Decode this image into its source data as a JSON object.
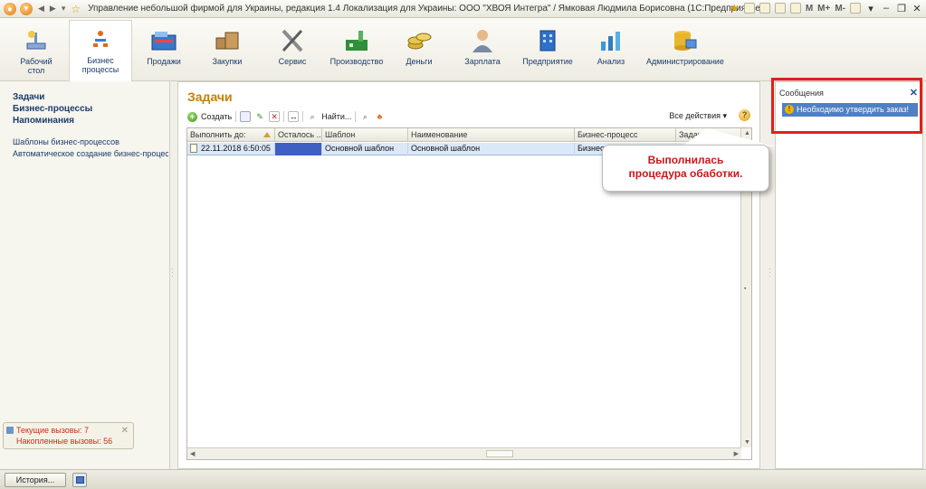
{
  "window": {
    "title": "Управление небольшой фирмой для Украины, редакция 1.4 Локализация для Украины: ООО \"ХВОЯ Интегра\" / Ямковая Людмила Борисовна  (1С:Предприятие)",
    "m_labels": [
      "M",
      "M+",
      "M-"
    ]
  },
  "sections": [
    {
      "label": "Рабочий стол",
      "icon": "desktop-icon"
    },
    {
      "label": "Бизнес процессы",
      "icon": "business-process-icon"
    },
    {
      "label": "Продажи",
      "icon": "cash-register-icon"
    },
    {
      "label": "Закупки",
      "icon": "boxes-icon"
    },
    {
      "label": "Сервис",
      "icon": "tools-icon"
    },
    {
      "label": "Производство",
      "icon": "factory-icon"
    },
    {
      "label": "Деньги",
      "icon": "coins-icon"
    },
    {
      "label": "Зарплата",
      "icon": "person-icon"
    },
    {
      "label": "Предприятие",
      "icon": "building-icon"
    },
    {
      "label": "Анализ",
      "icon": "chart-icon"
    },
    {
      "label": "Администрирование",
      "icon": "database-icon"
    }
  ],
  "left_panel": {
    "bold_items": [
      "Задачи",
      "Бизнес-процессы",
      "Напоминания"
    ],
    "items": [
      "Шаблоны бизнес-процессов",
      "Автоматическое создание бизнес-процес..."
    ],
    "calls": {
      "current": "Текущие вызовы: 7",
      "accumulated": "Накопленные вызовы: 56"
    }
  },
  "main": {
    "title": "Задачи",
    "toolbar": {
      "create": "Создать",
      "find": "Найти...",
      "all_actions": "Все действия ▾",
      "help": "?"
    },
    "table": {
      "columns": [
        "Выполнить до:",
        "Осталось ...",
        "Шаблон",
        "Наименование",
        "Бизнес-процесс",
        "Задание"
      ],
      "rows": [
        {
          "due": "22.11.2018 6:50:05",
          "remaining": "",
          "template": "Основной шаблон",
          "name": "Основной шаблон",
          "process": "Бизнес",
          "task": ""
        }
      ]
    }
  },
  "callout": {
    "line1": "Выполнилась",
    "line2": "процедура обаботки."
  },
  "messages": {
    "title": "Сообщения",
    "item": "Необходимо утвердить заказ!",
    "close": "✕"
  },
  "bottom": {
    "history": "История..."
  },
  "colors": {
    "accent_title": "#c77d0c",
    "highlight_red": "#e01f1f",
    "selection_blue": "#4f7fc4"
  }
}
